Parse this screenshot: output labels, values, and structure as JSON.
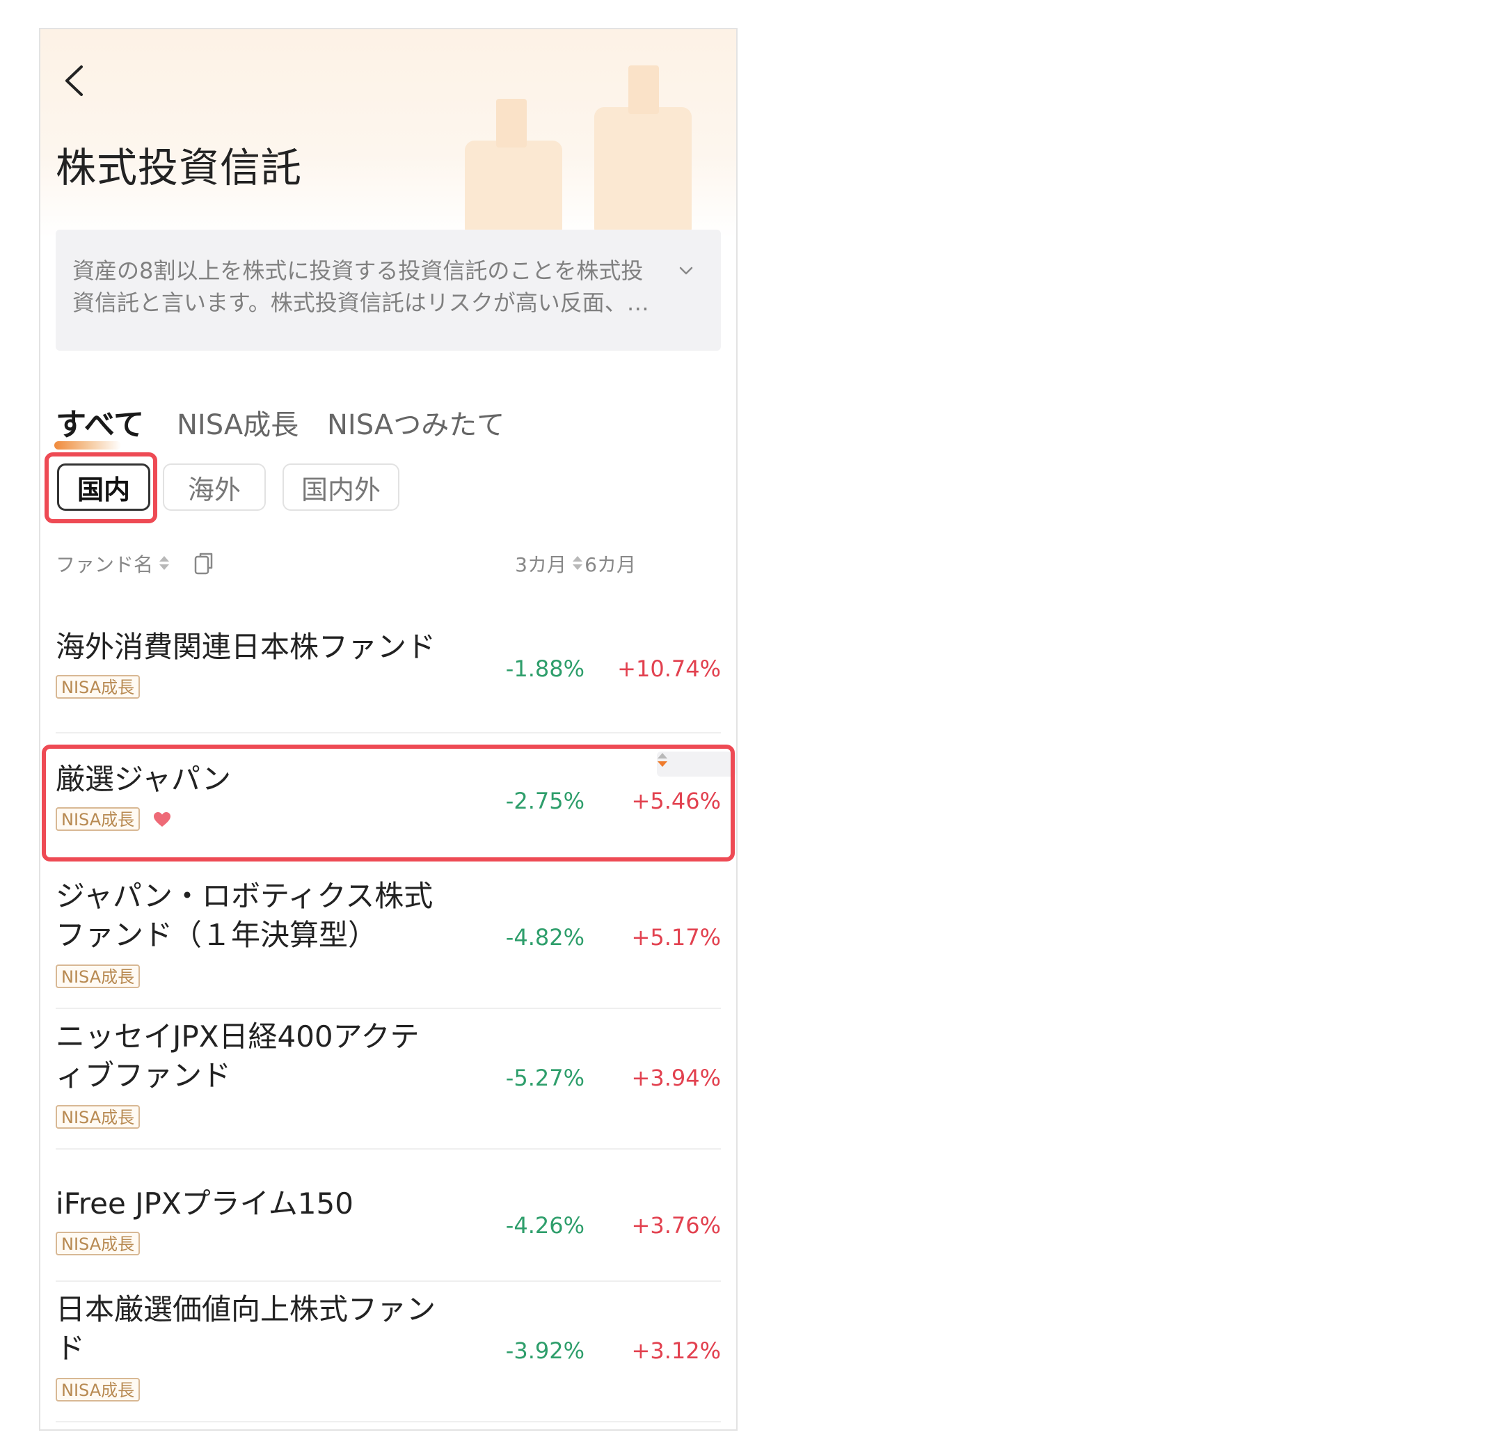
{
  "page": {
    "title": "株式投資信託",
    "description": "資産の8割以上を株式に投資する投資信託のことを株式投資信託と言います。株式投資信託はリスクが高い反面、…"
  },
  "tabs": [
    {
      "label": "すべて",
      "active": true
    },
    {
      "label": "NISA成長",
      "active": false
    },
    {
      "label": "NISAつみたて",
      "active": false
    }
  ],
  "chips": [
    {
      "label": "国内",
      "active": true
    },
    {
      "label": "海外",
      "active": false
    },
    {
      "label": "国内外",
      "active": false
    }
  ],
  "table": {
    "headers": {
      "name": "ファンド名",
      "m3": "3カ月",
      "m6": "6カ月"
    },
    "rows": [
      {
        "name": "海外消費関連日本株ファンド",
        "badge": "NISA成長",
        "m3": "-1.88%",
        "m6": "+10.74%",
        "favorite": false
      },
      {
        "name": "厳選ジャパン",
        "badge": "NISA成長",
        "m3": "-2.75%",
        "m6": "+5.46%",
        "favorite": true
      },
      {
        "name": "ジャパン・ロボティクス株式ファンド（１年決算型）",
        "badge": "NISA成長",
        "m3": "-4.82%",
        "m6": "+5.17%",
        "favorite": false
      },
      {
        "name": "ニッセイJPX日経400アクティブファンド",
        "badge": "NISA成長",
        "m3": "-5.27%",
        "m6": "+3.94%",
        "favorite": false
      },
      {
        "name": "iFree JPXプライム150",
        "badge": "NISA成長",
        "m3": "-4.26%",
        "m6": "+3.76%",
        "favorite": false
      },
      {
        "name": "日本厳選価値向上株式ファンド",
        "badge": "NISA成長",
        "m3": "-3.92%",
        "m6": "+3.12%",
        "favorite": false
      }
    ]
  },
  "colors": {
    "negative": "#2e9e6b",
    "positive": "#e2414f",
    "accent": "#ef7b2c",
    "highlight": "#ee4a54"
  },
  "icons": {
    "back": "chevron-left-icon",
    "expand": "chevron-down-icon",
    "sort": "sort-icon",
    "copy": "copy-icon",
    "favorite": "heart-icon"
  }
}
